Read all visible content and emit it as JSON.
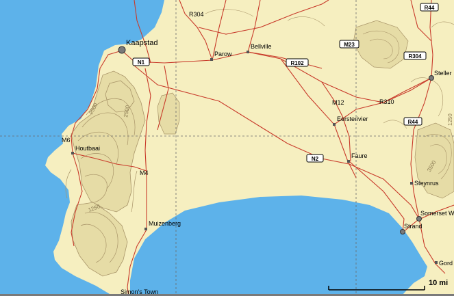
{
  "map": {
    "colors": {
      "land": "#f6efc0",
      "water": "#5db2ea",
      "road": "#c83a2a",
      "contour": "#a89468",
      "hill_fill": "#e6dca6",
      "grid": "#6a6a6a"
    },
    "places": {
      "kaapstad": "Kaapstad",
      "parow": "Parow",
      "bellville": "Bellville",
      "houtbaai": "Houtbaai",
      "eersterivier": "Eersterivier",
      "faure": "Faure",
      "muizenberg": "Muizenberg",
      "steynrus": "Steynrus",
      "somerset": "Somerset W",
      "strand": "Strand",
      "stellenbosch": "Steller",
      "gordons": "Gord",
      "simonstown": "Simon's Town"
    },
    "road_labels": {
      "r304_top": "R304",
      "m12": "M12",
      "r310": "R310",
      "m6": "M6",
      "m4": "M4"
    },
    "shields": {
      "n1": "N1",
      "r102": "R102",
      "m23": "M23",
      "n2": "N2",
      "r44_top": "R44",
      "r304_right": "R304",
      "r44_mid": "R44"
    },
    "contours": {
      "c2500_a": "2500",
      "c2500_b": "2500",
      "c1250": "1250",
      "c3500": "3500",
      "c1250_right": "1250"
    },
    "scale": {
      "label": "10 mi"
    }
  }
}
